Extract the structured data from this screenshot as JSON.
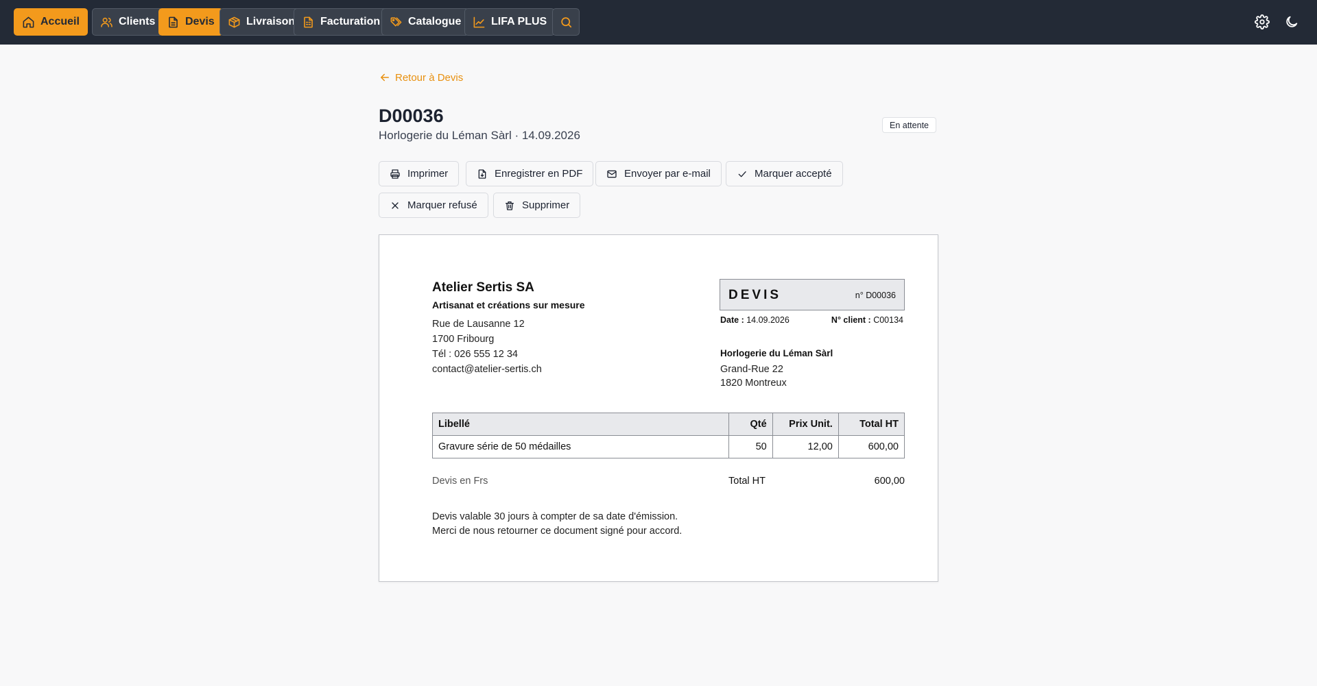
{
  "nav": {
    "items": [
      {
        "label": "Accueil",
        "icon": "home-icon",
        "active": true
      },
      {
        "label": "Clients",
        "icon": "users-icon",
        "active": false
      },
      {
        "label": "Devis",
        "icon": "document-icon",
        "active": true
      },
      {
        "label": "Livraison",
        "icon": "box-icon",
        "active": false
      },
      {
        "label": "Facturation",
        "icon": "invoice-icon",
        "active": false
      },
      {
        "label": "Catalogue",
        "icon": "tags-icon",
        "active": false
      },
      {
        "label": "LIFA PLUS",
        "icon": "chart-line-icon",
        "active": false
      }
    ],
    "search_icon": "search-icon",
    "settings_icon": "gear-icon",
    "theme_icon": "moon-icon",
    "accent_color": "#f39a1c"
  },
  "back_link": "Retour à Devis",
  "quote": {
    "number": "D00036",
    "subtitle": "Horlogerie du Léman Sàrl · 14.09.2026",
    "status": "En attente"
  },
  "actions": {
    "print": "Imprimer",
    "pdf": "Enregistrer en PDF",
    "email": "Envoyer par e-mail",
    "accept": "Marquer accepté",
    "refuse": "Marquer refusé",
    "delete": "Supprimer"
  },
  "document": {
    "company": {
      "name": "Atelier Sertis SA",
      "tagline": "Artisanat et créations sur mesure",
      "street": "Rue de Lausanne 12",
      "city": "1700 Fribourg",
      "phone": "Tél : 026 555 12 34",
      "email": "contact@atelier-sertis.ch"
    },
    "title": "DEVIS",
    "number": "n° D00036",
    "date_label": "Date :",
    "date": "14.09.2026",
    "client_no_label": "N° client :",
    "client_no": "C00134",
    "client": {
      "name": "Horlogerie du Léman Sàrl",
      "street": "Grand-Rue 22",
      "city": "1820 Montreux"
    },
    "table": {
      "headers": [
        "Libellé",
        "Qté",
        "Prix Unit.",
        "Total HT"
      ],
      "rows": [
        [
          "Gravure série de 50 médailles",
          "50",
          "12,00",
          "600,00"
        ]
      ]
    },
    "currency_note": "Devis en Frs",
    "total_label": "Total HT",
    "total_value": "600,00",
    "notes": [
      "Devis valable 30 jours à compter de sa date d'émission.",
      "Merci de nous retourner ce document signé pour accord."
    ]
  }
}
